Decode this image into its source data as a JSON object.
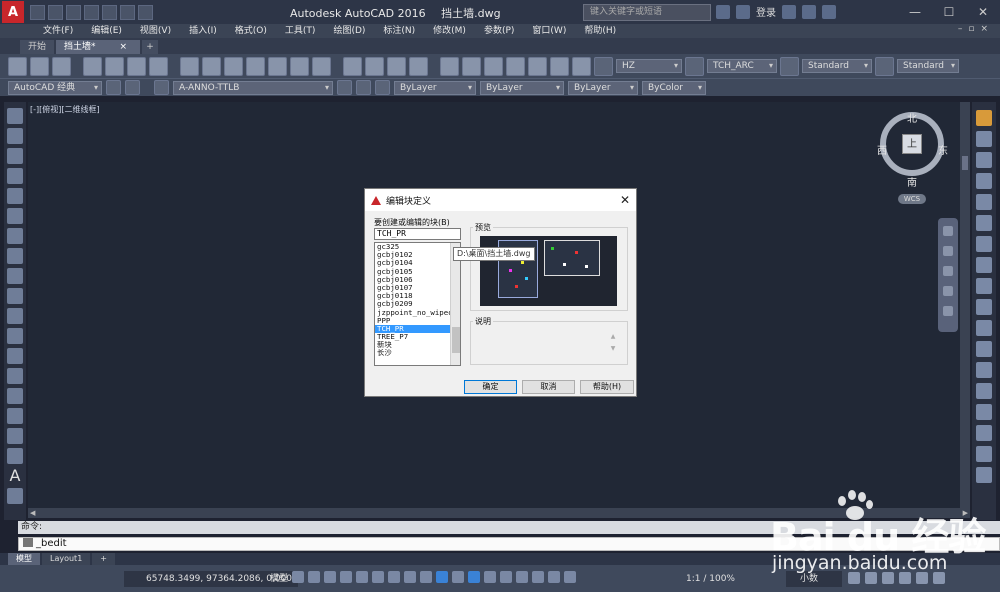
{
  "window": {
    "app_title": "Autodesk AutoCAD 2016",
    "file_name": "挡土墙.dwg",
    "search_placeholder": "键入关键字或短语",
    "login_label": "登录"
  },
  "menu": [
    "文件(F)",
    "编辑(E)",
    "视图(V)",
    "插入(I)",
    "格式(O)",
    "工具(T)",
    "绘图(D)",
    "标注(N)",
    "修改(M)",
    "参数(P)",
    "窗口(W)",
    "帮助(H)"
  ],
  "doc_tabs": {
    "start": "开始",
    "active": "挡土墙*",
    "close": "×",
    "add": "+"
  },
  "toolbar1": {
    "text_style": "HZ",
    "dim_style": "TCH_ARC",
    "table_style": "Standard",
    "multileader_style": "Standard"
  },
  "toolbar2": {
    "workspace": "AutoCAD 经典",
    "layer": "A-ANNO-TTLB",
    "color": "ByLayer",
    "linetype": "ByLayer",
    "lineweight": "ByLayer",
    "plotstyle": "ByColor"
  },
  "viewport": {
    "label": "[-][俯视][二维线框]"
  },
  "viewcube": {
    "north": "北",
    "south": "南",
    "east": "东",
    "west": "西",
    "top": "上",
    "wcs": "WCS"
  },
  "dialog": {
    "title": "编辑块定义",
    "close": "✕",
    "prompt": "要创建或编辑的块(B)",
    "input_value": "TCH_PR",
    "block_items": [
      "gc325",
      "gcbj0102",
      "gcbj0104",
      "gcbj0105",
      "gcbj0106",
      "gcbj0107",
      "gcbj0118",
      "gcbj0209",
      "jzppoint_no_wipeout",
      "PPP",
      "TCH_PR",
      "TREE_P7",
      "新块",
      "长沙"
    ],
    "selected_index": 10,
    "preview_label": "预览",
    "description_label": "说明",
    "tooltip": "D:\\桌面\\挡土墙.dwg",
    "ok": "确定",
    "cancel": "取消",
    "help": "帮助(H)"
  },
  "command": {
    "history": "命令:",
    "current": "_bedit"
  },
  "layout_tabs": [
    "模型",
    "Layout1",
    "+"
  ],
  "status": {
    "coords": "65748.3499, 97364.2086, 0.0000",
    "model": "模型",
    "scale": "1:1 / 100%",
    "units": "小数"
  },
  "watermark": {
    "logo": "Bai du 经验",
    "url": "jingyan.baidu.com"
  }
}
